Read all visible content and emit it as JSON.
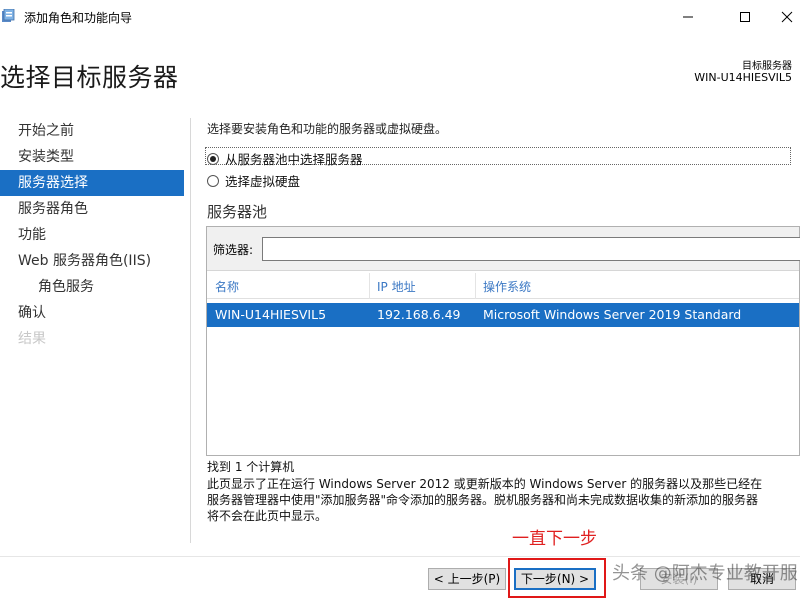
{
  "window": {
    "title": "添加角色和功能向导"
  },
  "header": {
    "page_title": "选择目标服务器",
    "destination_label": "目标服务器",
    "destination_value": "WIN-U14HIESVIL5"
  },
  "nav": {
    "items": [
      {
        "label": "开始之前"
      },
      {
        "label": "安装类型"
      },
      {
        "label": "服务器选择"
      },
      {
        "label": "服务器角色"
      },
      {
        "label": "功能"
      },
      {
        "label": "Web 服务器角色(IIS)"
      },
      {
        "label": "角色服务"
      },
      {
        "label": "确认"
      },
      {
        "label": "结果"
      }
    ]
  },
  "content": {
    "instruction": "选择要安装角色和功能的服务器或虚拟硬盘。",
    "radio_pool": "从服务器池中选择服务器",
    "radio_vhd": "选择虚拟硬盘",
    "pool_heading": "服务器池",
    "filter_label": "筛选器:",
    "filter_value": "",
    "columns": {
      "name": "名称",
      "ip": "IP 地址",
      "os": "操作系统"
    },
    "server": {
      "name": "WIN-U14HIESVIL5",
      "ip": "192.168.6.49",
      "os": "Microsoft Windows Server 2019 Standard"
    },
    "found": "找到 1 个计算机",
    "desc_lines": [
      "此页显示了正在运行 Windows Server 2012 或更新版本的 Windows Server 的服务器以及那些已经在",
      "服务器管理器中使用\"添加服务器\"命令添加的服务器。脱机服务器和尚未完成数据收集的新添加的服务器",
      "将不会在此页中显示。"
    ]
  },
  "annotation": {
    "text": "一直下一步",
    "color": "#e02020"
  },
  "buttons": {
    "prev": "< 上一步(P)",
    "next": "下一步(N) >",
    "install": "安装(I)",
    "cancel": "取消"
  },
  "watermark": "头条 @阿杰专业教开服",
  "colors": {
    "accent": "#1a6fc4",
    "annotation": "#e01818"
  },
  "icons": [
    "app-icon",
    "minimize-icon",
    "maximize-icon",
    "close-icon"
  ]
}
